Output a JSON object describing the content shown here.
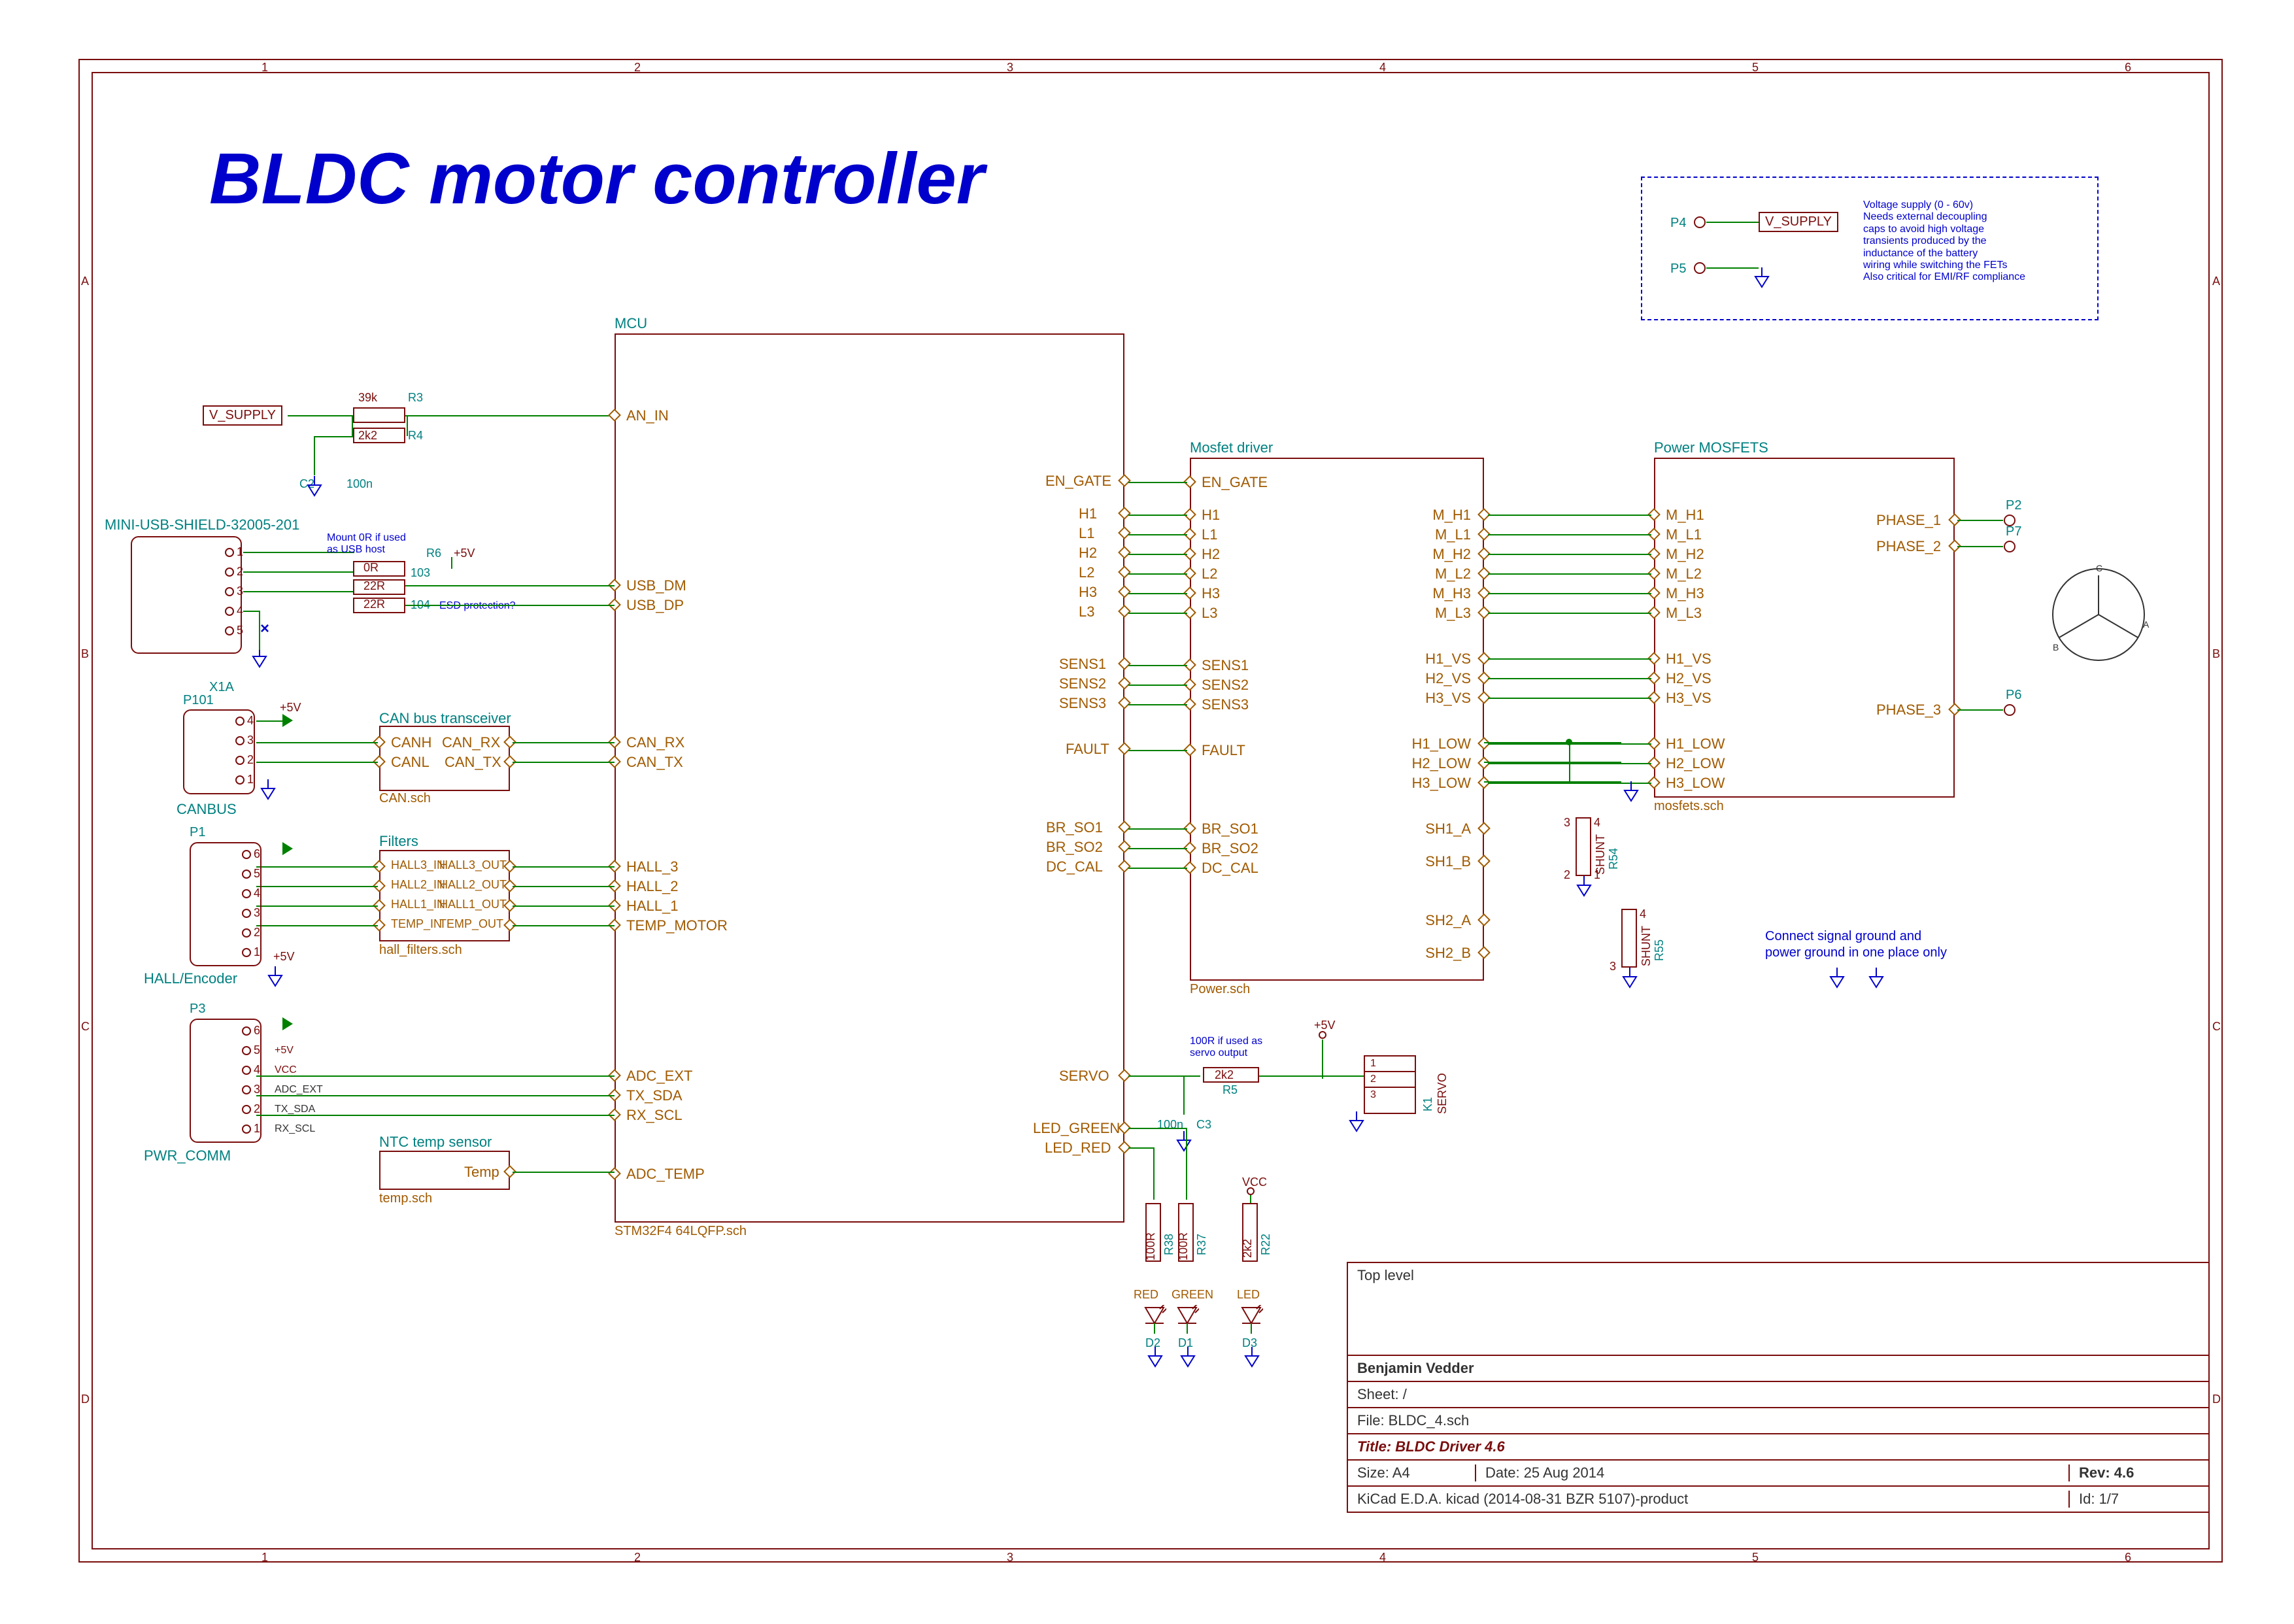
{
  "title": "BLDC motor controller",
  "grid": {
    "cols": [
      "1",
      "2",
      "3",
      "4",
      "5",
      "6"
    ],
    "rows": [
      "A",
      "B",
      "C",
      "D"
    ]
  },
  "supply_note": {
    "net": "V_SUPPLY",
    "p4": "P4",
    "p5": "P5",
    "text": "Voltage supply (0 - 60v)\nNeeds external decoupling\ncaps to avoid high voltage\ntransients produced by the\ninductance of the battery\nwiring while switching the FETs\nAlso critical for EMI/RF compliance"
  },
  "ground_note": "Connect signal ground and\npower ground in one place only",
  "mcu": {
    "label": "MCU",
    "sch": "STM32F4 64LQFP.sch",
    "left_pins": [
      "AN_IN",
      "USB_DM",
      "USB_DP",
      "CAN_RX",
      "CAN_TX",
      "HALL_3",
      "HALL_2",
      "HALL_1",
      "TEMP_MOTOR",
      "ADC_EXT",
      "TX_SDA",
      "RX_SCL",
      "ADC_TEMP"
    ],
    "right_pins": [
      "EN_GATE",
      "H1",
      "L1",
      "H2",
      "L2",
      "H3",
      "L3",
      "SENS1",
      "SENS2",
      "SENS3",
      "FAULT",
      "BR_SO1",
      "BR_SO2",
      "DC_CAL",
      "SERVO",
      "LED_GREEN",
      "LED_RED"
    ]
  },
  "driver": {
    "label": "Mosfet driver",
    "sch": "Power.sch",
    "left_pins": [
      "EN_GATE",
      "H1",
      "L1",
      "H2",
      "L2",
      "H3",
      "L3",
      "SENS1",
      "SENS2",
      "SENS3",
      "FAULT",
      "BR_SO1",
      "BR_SO2",
      "DC_CAL"
    ],
    "right_pins": [
      "M_H1",
      "M_L1",
      "M_H2",
      "M_L2",
      "M_H3",
      "M_L3",
      "H1_VS",
      "H2_VS",
      "H3_VS",
      "H1_LOW",
      "H2_LOW",
      "H3_LOW",
      "SH1_A",
      "SH1_B",
      "SH2_A",
      "SH2_B"
    ]
  },
  "mosfets": {
    "label": "Power MOSFETS",
    "sch": "mosfets.sch",
    "left_pins": [
      "M_H1",
      "M_L1",
      "M_H2",
      "M_L2",
      "M_H3",
      "M_L3",
      "H1_VS",
      "H2_VS",
      "H3_VS",
      "H1_LOW",
      "H2_LOW",
      "H3_LOW"
    ],
    "phases": [
      "PHASE_1",
      "PHASE_2",
      "PHASE_3"
    ],
    "phase_refs": [
      "P2",
      "P7",
      "P6"
    ]
  },
  "can": {
    "label": "CAN bus transceiver",
    "sch": "CAN.sch",
    "left": [
      "CANH",
      "CANL"
    ],
    "right": [
      "CAN_RX",
      "CAN_TX"
    ]
  },
  "filters": {
    "label": "Filters",
    "sch": "hall_filters.sch",
    "left": [
      "HALL3_IN",
      "HALL2_IN",
      "HALL1_IN",
      "TEMP_IN"
    ],
    "right": [
      "HALL3_OUT",
      "HALL2_OUT",
      "HALL1_OUT",
      "TEMP_OUT"
    ]
  },
  "temp_block": {
    "label": "NTC temp sensor",
    "sch": "temp.sch",
    "pin": "Temp"
  },
  "vsupply_net": "V_SUPPLY",
  "an_in": {
    "r3_ref": "R3",
    "r3_val": "39k",
    "r4_ref": "R4",
    "r4_val": "2k2",
    "c2_ref": "C2",
    "c2_val": "100n"
  },
  "usb": {
    "label": "MINI-USB-SHIELD-32005-201",
    "ref": "X1A",
    "pins": [
      "1",
      "2",
      "3",
      "4",
      "5"
    ],
    "mount_note": "Mount 0R if used\nas USB host",
    "r6": "R6",
    "r6_val": "0R",
    "r103": "103",
    "r103_val": "22R",
    "r104": "104",
    "r104_val": "22R",
    "esd_note": "ESD protection?",
    "pwr": "+5V"
  },
  "canbus_conn": {
    "ref": "P101",
    "name": "CANBUS",
    "pins": [
      "4",
      "3",
      "2",
      "1"
    ],
    "pwr": "+5V"
  },
  "hall_conn": {
    "ref": "P1",
    "name": "HALL/Encoder",
    "pins": [
      "6",
      "5",
      "4",
      "3",
      "2",
      "1"
    ],
    "pwr": "+5V"
  },
  "pwr_comm_conn": {
    "ref": "P3",
    "name": "PWR_COMM",
    "pins": [
      "6",
      "5",
      "4",
      "3",
      "2",
      "1"
    ],
    "sig": [
      "",
      "+5V",
      "VCC",
      "ADC_EXT",
      "TX_SDA",
      "RX_SCL"
    ]
  },
  "servo": {
    "r5_ref": "R5",
    "r5_val": "2k2",
    "c3_ref": "C3",
    "c3_val": "100n",
    "note": "100R if used as\nservo output",
    "conn_ref": "K1",
    "conn_name": "SERVO",
    "pins": [
      "1",
      "2",
      "3"
    ],
    "pwr": "+5V"
  },
  "leds": {
    "r38": {
      "ref": "R38",
      "val": "100R"
    },
    "r37": {
      "ref": "R37",
      "val": "100R"
    },
    "r22": {
      "ref": "R22",
      "val": "2k2"
    },
    "d2": {
      "ref": "D2",
      "name": "RED"
    },
    "d1": {
      "ref": "D1",
      "name": "GREEN"
    },
    "d3": {
      "ref": "D3",
      "name": "LED"
    },
    "vcc": "VCC"
  },
  "shunts": {
    "r54": "R54",
    "r55": "R55",
    "val": "SHUNT",
    "pins": [
      "1",
      "2",
      "3",
      "4"
    ]
  },
  "title_block": {
    "top": "Top level",
    "author": "Benjamin Vedder",
    "sheet": "Sheet:  /",
    "file": "File:  BLDC_4.sch",
    "title": "Title:  BLDC Driver 4.6",
    "size": "Size: A4",
    "date": "Date: 25 Aug 2014",
    "rev": "Rev:  4.6",
    "app": "KiCad E.D.A.   kicad (2014-08-31 BZR 5107)-product",
    "id": "Id: 1/7"
  },
  "motor_symbol_pins": [
    "A",
    "B",
    "C"
  ]
}
